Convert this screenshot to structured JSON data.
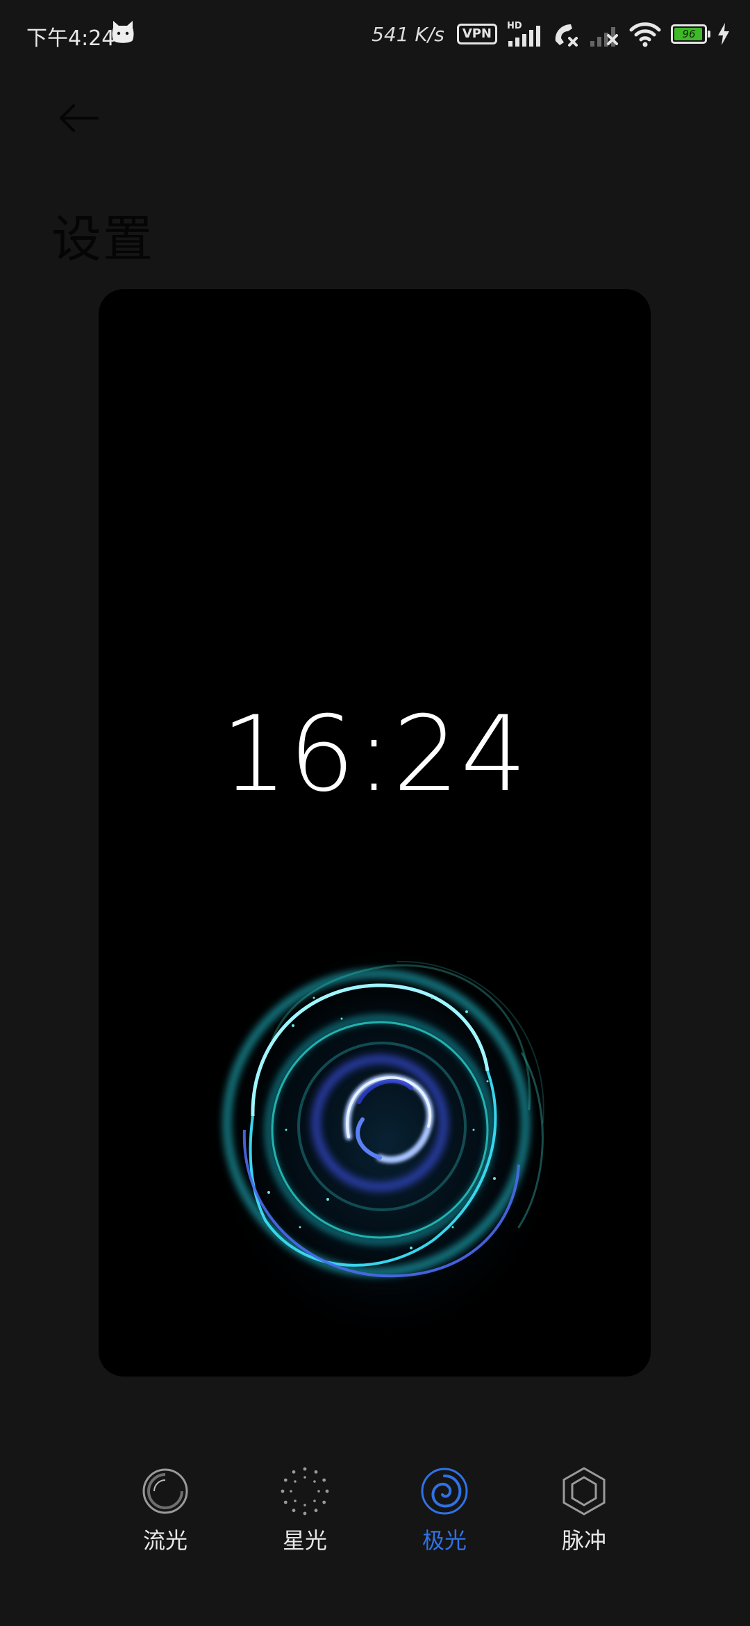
{
  "status_bar": {
    "time": "下午4:24",
    "net_speed": "541 K/s",
    "vpn_label": "VPN",
    "hd_label": "HD",
    "battery_level": "96",
    "battery_fraction": 0.96
  },
  "header": {
    "title": "设置"
  },
  "preview": {
    "clock": "16:24"
  },
  "effects": {
    "options": [
      {
        "label": "流光",
        "icon": "ring-icon"
      },
      {
        "label": "星光",
        "icon": "dotted-ring-icon"
      },
      {
        "label": "极光",
        "icon": "spiral-icon"
      },
      {
        "label": "脉冲",
        "icon": "hexagon-icon"
      }
    ],
    "selected_index": 2,
    "selected_color": "#2f72e6"
  }
}
